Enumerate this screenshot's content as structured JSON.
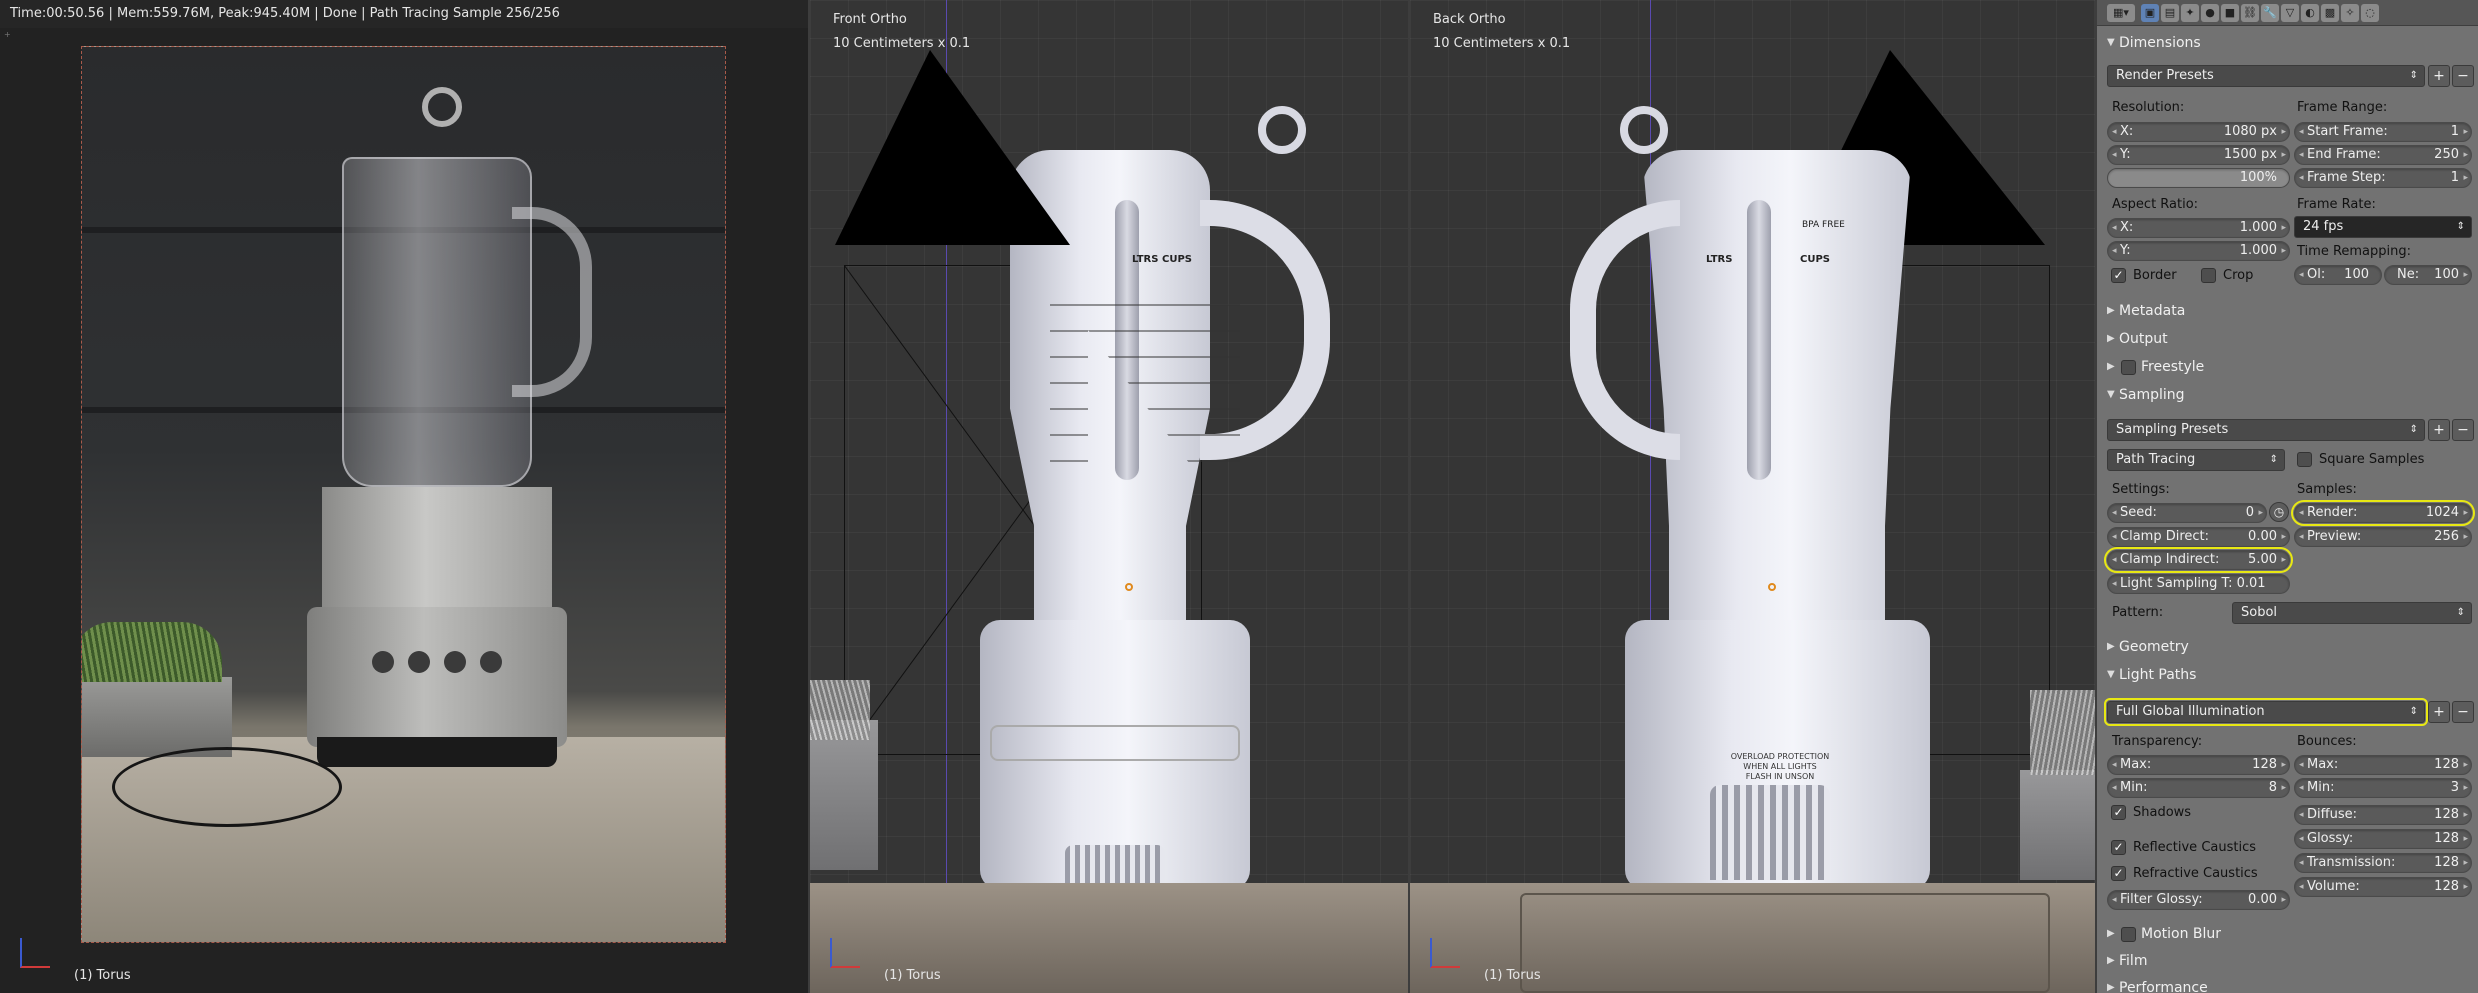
{
  "render_view": {
    "status": "Time:00:50.56 | Mem:559.76M, Peak:945.40M | Done | Path Tracing Sample 256/256",
    "object_label": "(1) Torus"
  },
  "front_view": {
    "title": "Front Ortho",
    "scale": "10 Centimeters x 0.1",
    "object_label": "(1) Torus"
  },
  "back_view": {
    "title": "Back Ortho",
    "scale": "10 Centimeters x 0.1",
    "object_label": "(1) Torus"
  },
  "jug_text": {
    "ltrs": "LTRS",
    "cups": "CUPS",
    "bpa": "BPA FREE",
    "overload": "OVERLOAD PROTECTION\nWHEN ALL LIGHTS\nFLASH IN UNSON"
  },
  "properties": {
    "dimensions": {
      "header": "Dimensions",
      "render_presets": "Render Presets",
      "resolution_label": "Resolution:",
      "res_x_label": "X:",
      "res_x": "1080 px",
      "res_y_label": "Y:",
      "res_y": "1500 px",
      "res_pct": "100%",
      "frame_range_label": "Frame Range:",
      "start_frame_label": "Start Frame:",
      "start_frame": "1",
      "end_frame_label": "End Frame:",
      "end_frame": "250",
      "frame_step_label": "Frame Step:",
      "frame_step": "1",
      "aspect_label": "Aspect Ratio:",
      "aspect_x_label": "X:",
      "aspect_x": "1.000",
      "aspect_y_label": "Y:",
      "aspect_y": "1.000",
      "frame_rate_label": "Frame Rate:",
      "frame_rate": "24 fps",
      "time_remap_label": "Time Remapping:",
      "old_label": "Ol:",
      "old": "100",
      "new_label": "Ne:",
      "new": "100",
      "border": "Border",
      "crop": "Crop"
    },
    "collapsed": {
      "metadata": "Metadata",
      "output": "Output",
      "freestyle": "Freestyle"
    },
    "sampling": {
      "header": "Sampling",
      "presets": "Sampling Presets",
      "integrator": "Path Tracing",
      "square_samples": "Square Samples",
      "settings_label": "Settings:",
      "seed_label": "Seed:",
      "seed": "0",
      "clamp_direct_label": "Clamp Direct:",
      "clamp_direct": "0.00",
      "clamp_indirect_label": "Clamp Indirect:",
      "clamp_indirect": "5.00",
      "light_sampling": "Light Sampling T: 0.01",
      "samples_label": "Samples:",
      "render_label": "Render:",
      "render": "1024",
      "preview_label": "Preview:",
      "preview": "256",
      "pattern_label": "Pattern:",
      "pattern": "Sobol"
    },
    "geometry": "Geometry",
    "light_paths": {
      "header": "Light Paths",
      "preset": "Full Global Illumination",
      "transparency_label": "Transparency:",
      "t_max_label": "Max:",
      "t_max": "128",
      "t_min_label": "Min:",
      "t_min": "8",
      "shadows": "Shadows",
      "reflective": "Reflective Caustics",
      "refractive": "Refractive Caustics",
      "filter_glossy_label": "Filter Glossy:",
      "filter_glossy": "0.00",
      "bounces_label": "Bounces:",
      "b_max_label": "Max:",
      "b_max": "128",
      "b_min_label": "Min:",
      "b_min": "3",
      "diffuse_label": "Diffuse:",
      "diffuse": "128",
      "glossy_label": "Glossy:",
      "glossy": "128",
      "transmission_label": "Transmission:",
      "transmission": "128",
      "volume_label": "Volume:",
      "volume": "128"
    },
    "motion_blur": "Motion Blur",
    "film": "Film",
    "performance": "Performance"
  },
  "colors": {
    "highlight": "#e8e813",
    "panel_bg": "#727272",
    "viewport_bg": "#353535"
  }
}
